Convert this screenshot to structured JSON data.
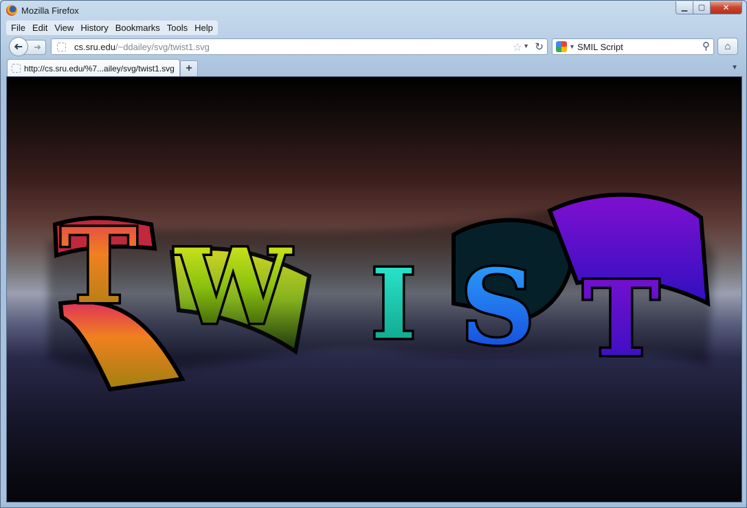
{
  "window": {
    "title": "Mozilla Firefox"
  },
  "menubar": {
    "items": [
      "File",
      "Edit",
      "View",
      "History",
      "Bookmarks",
      "Tools",
      "Help"
    ]
  },
  "navbar": {
    "url_domain": "cs.sru.edu",
    "url_path": "/~ddailey/svg/twist1.svg",
    "search_text": "SMIL Script"
  },
  "tabs": [
    {
      "label": "http://cs.sru.edu/%7...ailey/svg/twist1.svg"
    }
  ],
  "content": {
    "word": "TWIST",
    "letters": [
      {
        "char": "T",
        "color": "#e8402a"
      },
      {
        "char": "W",
        "color": "#b8d60a"
      },
      {
        "char": "I",
        "color": "#10d8b0"
      },
      {
        "char": "S",
        "color": "#1a7fff"
      },
      {
        "char": "T",
        "color": "#6a10e8"
      }
    ]
  },
  "icons": {
    "back": "back-arrow-icon",
    "forward": "forward-arrow-icon",
    "bookmark": "star-icon",
    "reload": "reload-icon",
    "search": "magnifier-icon",
    "home": "home-icon",
    "new_tab": "plus-icon",
    "list_tabs": "chevron-down-icon"
  }
}
